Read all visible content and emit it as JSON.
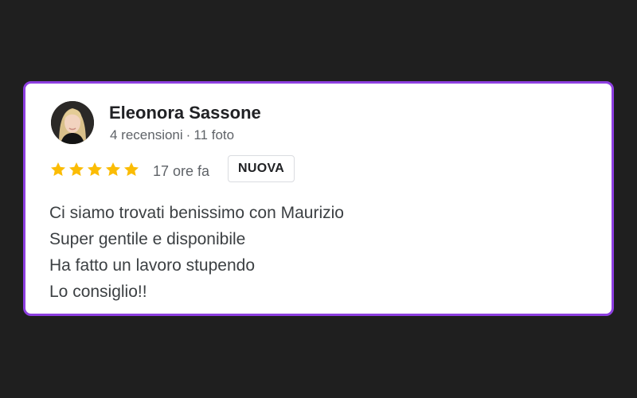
{
  "reviewer": {
    "name": "Eleonora Sassone",
    "reviews_count": "4 recensioni",
    "separator": "·",
    "photos_count": "11 foto"
  },
  "rating": {
    "stars": 5,
    "max_stars": 5,
    "star_color": "#fbbc04"
  },
  "review": {
    "time_ago": "17 ore fa",
    "badge": "NUOVA",
    "lines": [
      "Ci siamo trovati benissimo con Maurizio",
      "Super gentile e disponibile",
      "Ha fatto un lavoro stupendo",
      "Lo consiglio!!"
    ]
  },
  "colors": {
    "background": "#1f1f1f",
    "card_border": "#8d3fe0",
    "card_background": "#ffffff"
  }
}
